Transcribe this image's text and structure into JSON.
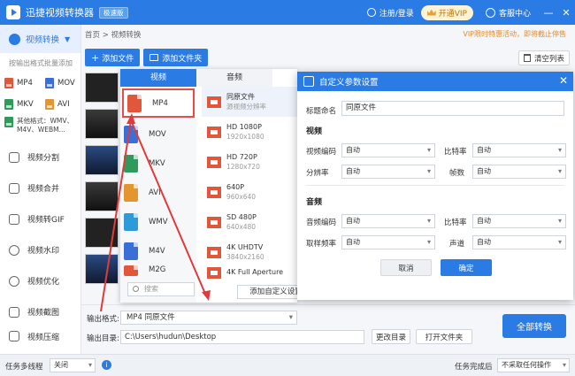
{
  "titlebar": {
    "title": "迅捷视频转换器",
    "badge": "极速版",
    "login": "注册/登录",
    "vip": "开通VIP",
    "service": "客服中心",
    "minimize": "—",
    "close": "✕"
  },
  "sidebar": {
    "section": "视频转换",
    "batch_hint": "按输出格式批量添加",
    "formats": [
      {
        "label": "MP4",
        "color": "#e0573c"
      },
      {
        "label": "MOV",
        "color": "#3b6fd8"
      },
      {
        "label": "MKV",
        "color": "#2f9a5c"
      },
      {
        "label": "AVI",
        "color": "#e3962f"
      }
    ],
    "other_formats": "其他格式：WMV、M4V、WEBM...",
    "nav": [
      "视频分割",
      "视频合并",
      "视频转GIF",
      "视频水印",
      "视频优化",
      "视频截图",
      "视频压缩"
    ]
  },
  "main": {
    "breadcrumb": "首页 > 视频转换",
    "promo": "VIP限时特惠活动，即将截止停售",
    "add_file": "添加文件",
    "add_folder": "添加文件夹",
    "clear_list": "清空列表",
    "output_format_label": "输出格式:",
    "output_format_value": "MP4  同原文件",
    "output_dir_label": "输出目录:",
    "output_dir_value": "C:\\Users\\hudun\\Desktop",
    "change_dir": "更改目录",
    "open_folder": "打开文件夹",
    "convert_all": "全部转换"
  },
  "format_popup": {
    "tabs": [
      "视频",
      "音频"
    ],
    "formats": [
      {
        "name": "MP4",
        "color": "#e0573c"
      },
      {
        "name": "MOV",
        "color": "#3b6fd8"
      },
      {
        "name": "MKV",
        "color": "#2f9a5c"
      },
      {
        "name": "AVI",
        "color": "#e3962f"
      },
      {
        "name": "WMV",
        "color": "#2f9ad8"
      },
      {
        "name": "M4V",
        "color": "#3b6fd8"
      },
      {
        "name": "M2G",
        "color": "#e0573c"
      }
    ],
    "search_placeholder": "搜索",
    "presets": [
      {
        "name": "同原文件",
        "sub": "源视频分辨率"
      },
      {
        "name": "HD 1080P",
        "sub": "1920x1080"
      },
      {
        "name": "HD 720P",
        "sub": "1280x720"
      },
      {
        "name": "640P",
        "sub": "960x640"
      },
      {
        "name": "SD 480P",
        "sub": "640x480"
      },
      {
        "name": "4K UHDTV",
        "sub": "3840x2160"
      },
      {
        "name": "4K Full Aperture",
        "sub": ""
      }
    ],
    "add_custom": "添加自定义设置"
  },
  "dialog": {
    "title": "自定义参数设置",
    "close": "✕",
    "title_label": "标题命名",
    "title_value": "同原文件",
    "video_heading": "视频",
    "video_codec_label": "视频编码",
    "video_bitrate_label": "比特率",
    "resolution_label": "分辨率",
    "fps_label": "帧数",
    "audio_heading": "音频",
    "audio_codec_label": "音频编码",
    "audio_bitrate_label": "比特率",
    "sample_rate_label": "取样频率",
    "channel_label": "声道",
    "auto": "自动",
    "cancel": "取消",
    "ok": "确定"
  },
  "statusbar": {
    "multithread_label": "任务多线程",
    "multithread_value": "关闭",
    "done_label": "任务完成后",
    "done_value": "不采取任何操作"
  }
}
